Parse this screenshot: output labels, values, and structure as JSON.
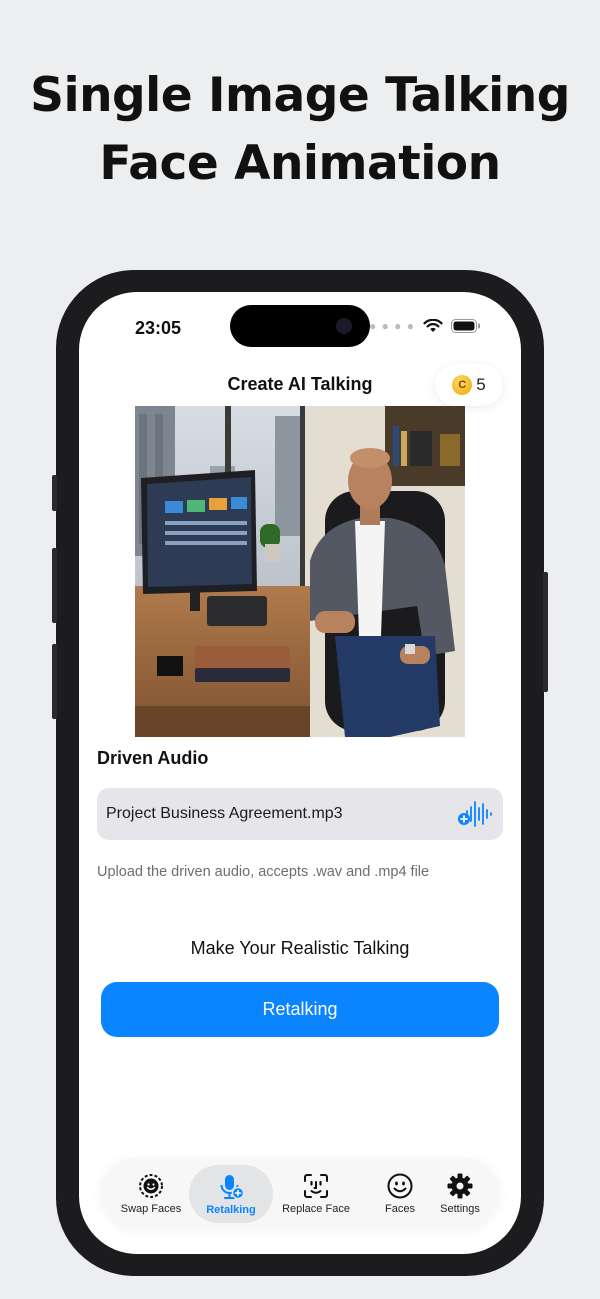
{
  "headline": {
    "line1": "Single Image Talking",
    "line2": "Face Animation"
  },
  "status_bar": {
    "time": "23:05"
  },
  "nav": {
    "title": "Create AI Talking",
    "coins": "5",
    "coin_icon_letter": "C"
  },
  "audio": {
    "section_title": "Driven Audio",
    "file_name": "Project Business Agreement.mp3",
    "hint": "Upload the driven audio, accepts .wav and .mp4 file"
  },
  "action": {
    "heading": "Make Your Realistic Talking",
    "button_label": "Retalking"
  },
  "tabs": [
    {
      "label": "Swap Faces",
      "icon": "swap-faces-icon"
    },
    {
      "label": "Retalking",
      "icon": "mic-add-icon",
      "active": true
    },
    {
      "label": "Replace Face",
      "icon": "face-scan-icon"
    },
    {
      "label": "Faces",
      "icon": "smiley-icon"
    },
    {
      "label": "Settings",
      "icon": "gear-icon"
    }
  ],
  "colors": {
    "accent": "#0a84ff",
    "background": "#eceef0",
    "field": "#e5e5ea"
  }
}
